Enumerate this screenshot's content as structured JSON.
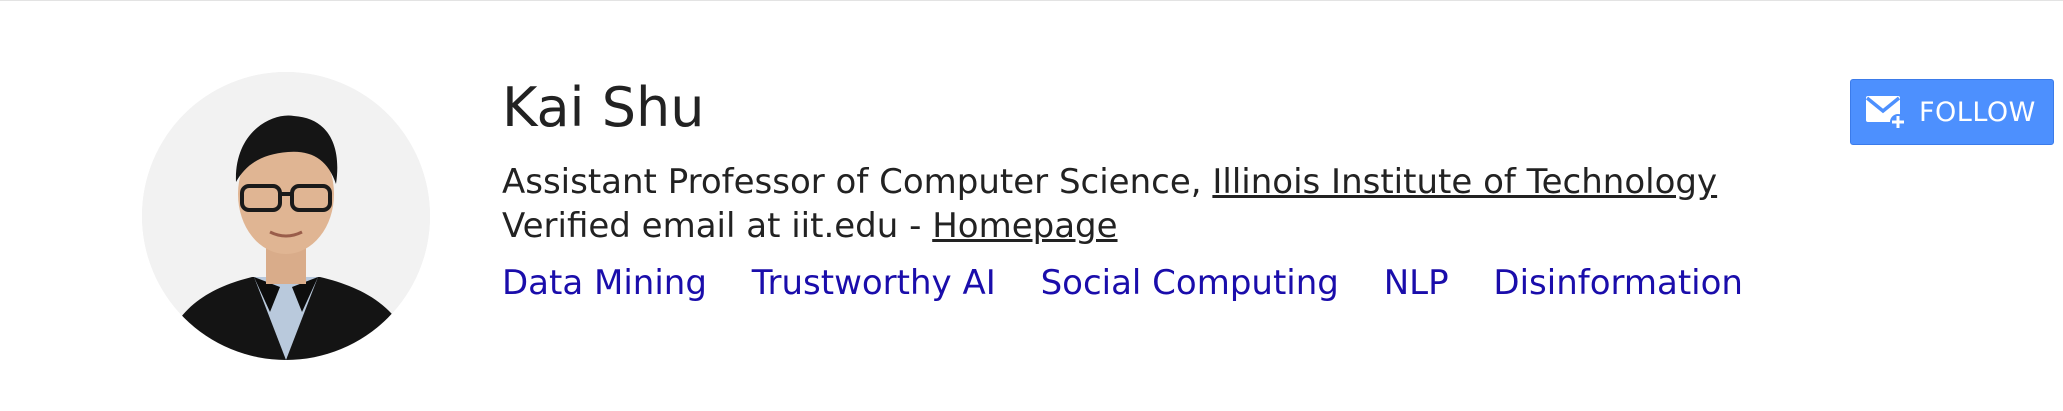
{
  "profile": {
    "name": "Kai Shu",
    "position": "Assistant Professor of Computer Science, ",
    "institution": "Illinois Institute of Technology",
    "email_text": "Verified email at iit.edu - ",
    "homepage_label": "Homepage",
    "interests": [
      "Data Mining",
      "Trustworthy AI",
      "Social Computing",
      "NLP",
      "Disinformation"
    ]
  },
  "follow_button": {
    "label": "FOLLOW",
    "icon": "email-plus-icon"
  },
  "colors": {
    "interest_link": "#1a0dab",
    "follow_bg": "#4d90fe",
    "text": "#222222"
  },
  "avatar": {
    "icon": "profile-photo"
  }
}
